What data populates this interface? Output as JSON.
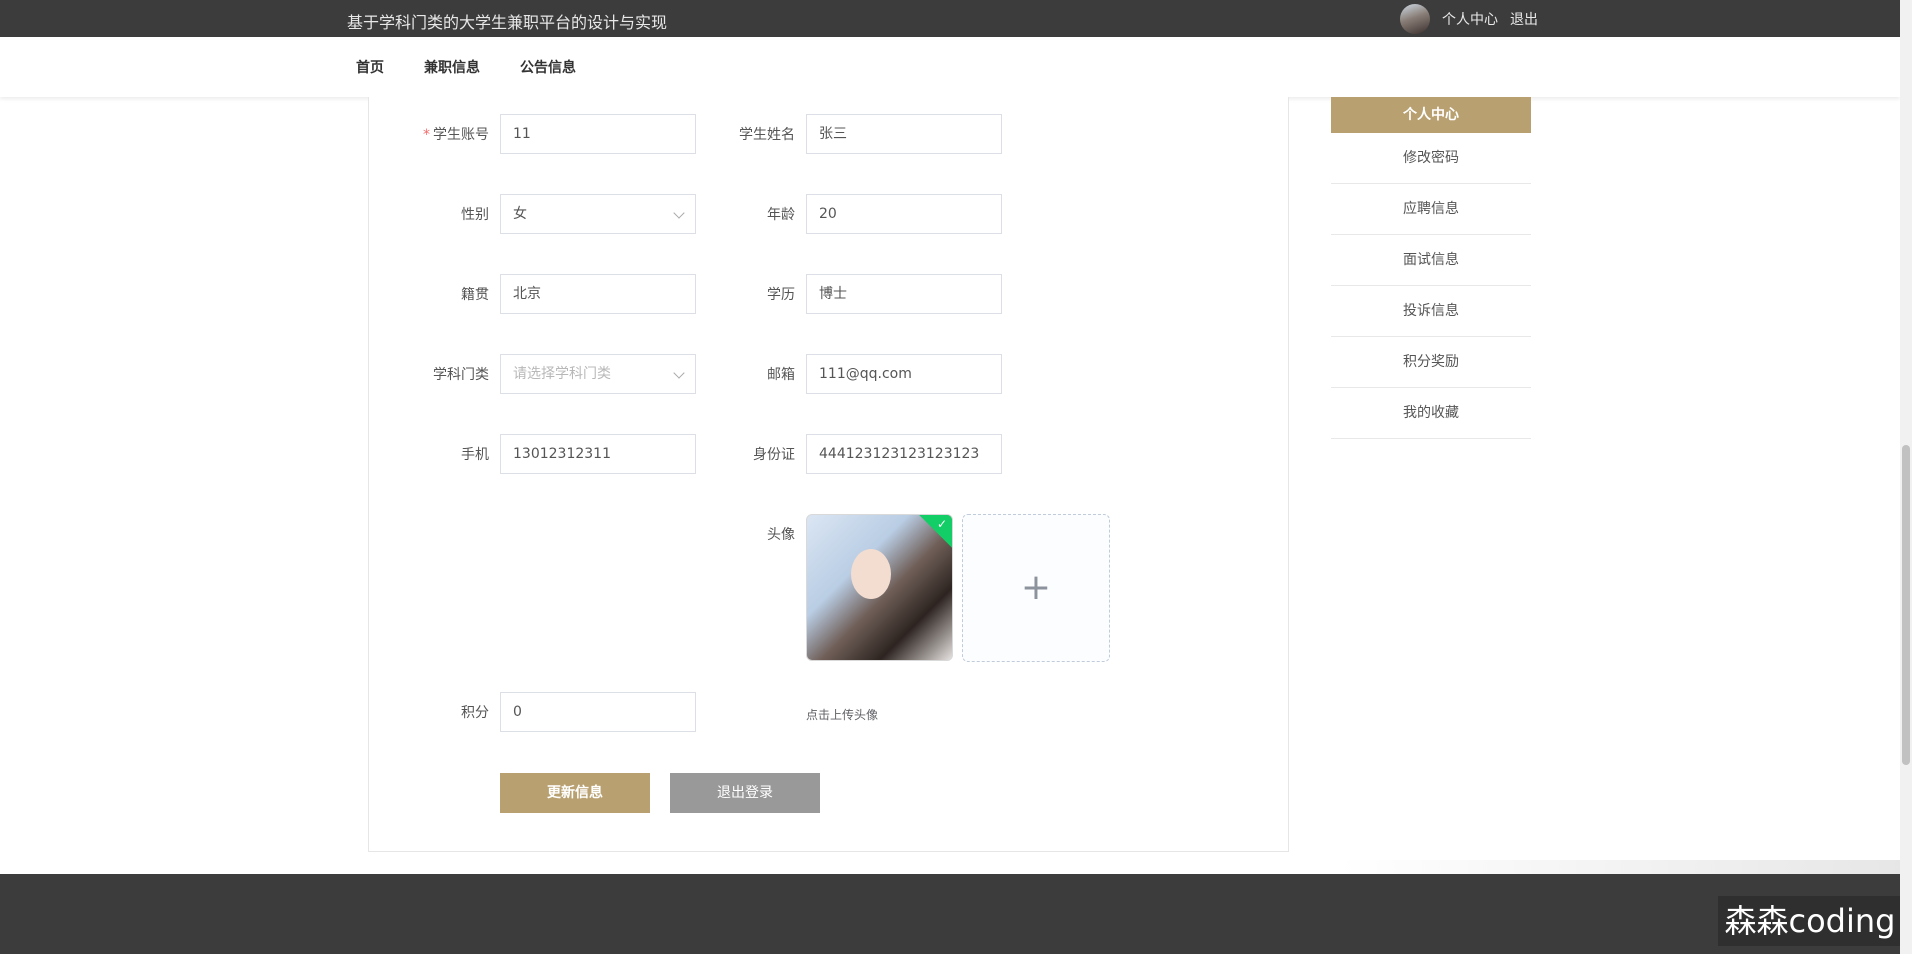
{
  "header": {
    "site_title": "基于学科门类的大学生兼职平台的设计与实现",
    "personal_center": "个人中心",
    "logout": "退出"
  },
  "nav": {
    "items": [
      {
        "label": "首页"
      },
      {
        "label": "兼职信息"
      },
      {
        "label": "公告信息"
      }
    ]
  },
  "form": {
    "student_account": {
      "label": "学生账号",
      "value": "11",
      "required": true
    },
    "student_name": {
      "label": "学生姓名",
      "value": "张三"
    },
    "gender": {
      "label": "性别",
      "value": "女"
    },
    "age": {
      "label": "年龄",
      "value": "20"
    },
    "hometown": {
      "label": "籍贯",
      "value": "北京"
    },
    "education": {
      "label": "学历",
      "value": "博士"
    },
    "discipline": {
      "label": "学科门类",
      "placeholder": "请选择学科门类"
    },
    "email": {
      "label": "邮箱",
      "value": "111@qq.com"
    },
    "phone": {
      "label": "手机",
      "value": "13012312311"
    },
    "id_card": {
      "label": "身份证",
      "value": "444123123123123123"
    },
    "avatar": {
      "label": "头像",
      "upload_hint": "点击上传头像"
    },
    "points": {
      "label": "积分",
      "value": "0"
    }
  },
  "buttons": {
    "update": "更新信息",
    "logout_account": "退出登录"
  },
  "sidebar": {
    "title": "个人中心",
    "items": [
      {
        "label": "修改密码"
      },
      {
        "label": "应聘信息"
      },
      {
        "label": "面试信息"
      },
      {
        "label": "投诉信息"
      },
      {
        "label": "积分奖励"
      },
      {
        "label": "我的收藏"
      }
    ]
  },
  "watermark": "森森coding",
  "colors": {
    "accent": "#b8a070",
    "topbar": "#3c3c3c",
    "success": "#13ce66"
  }
}
